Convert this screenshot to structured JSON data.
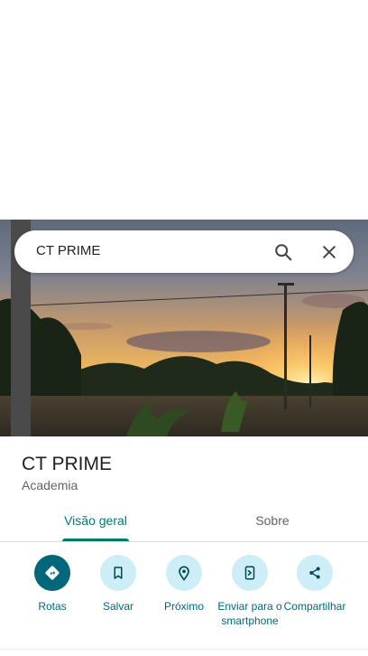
{
  "search": {
    "query": "CT PRIME"
  },
  "place": {
    "name": "CT PRIME",
    "category": "Academia"
  },
  "tabs": [
    {
      "label": "Visão geral",
      "active": true
    },
    {
      "label": "Sobre",
      "active": false
    }
  ],
  "actions": [
    {
      "label": "Rotas",
      "icon": "directions-icon"
    },
    {
      "label": "Salvar",
      "icon": "bookmark-icon"
    },
    {
      "label": "Próximo",
      "icon": "nearby-icon"
    },
    {
      "label": "Enviar para o smartphone",
      "icon": "send-to-phone-icon"
    },
    {
      "label": "Compartilhar",
      "icon": "share-icon"
    }
  ],
  "colors": {
    "accent": "#00796b",
    "action_primary_bg": "#00687a",
    "action_secondary_bg": "#cdeef6"
  }
}
